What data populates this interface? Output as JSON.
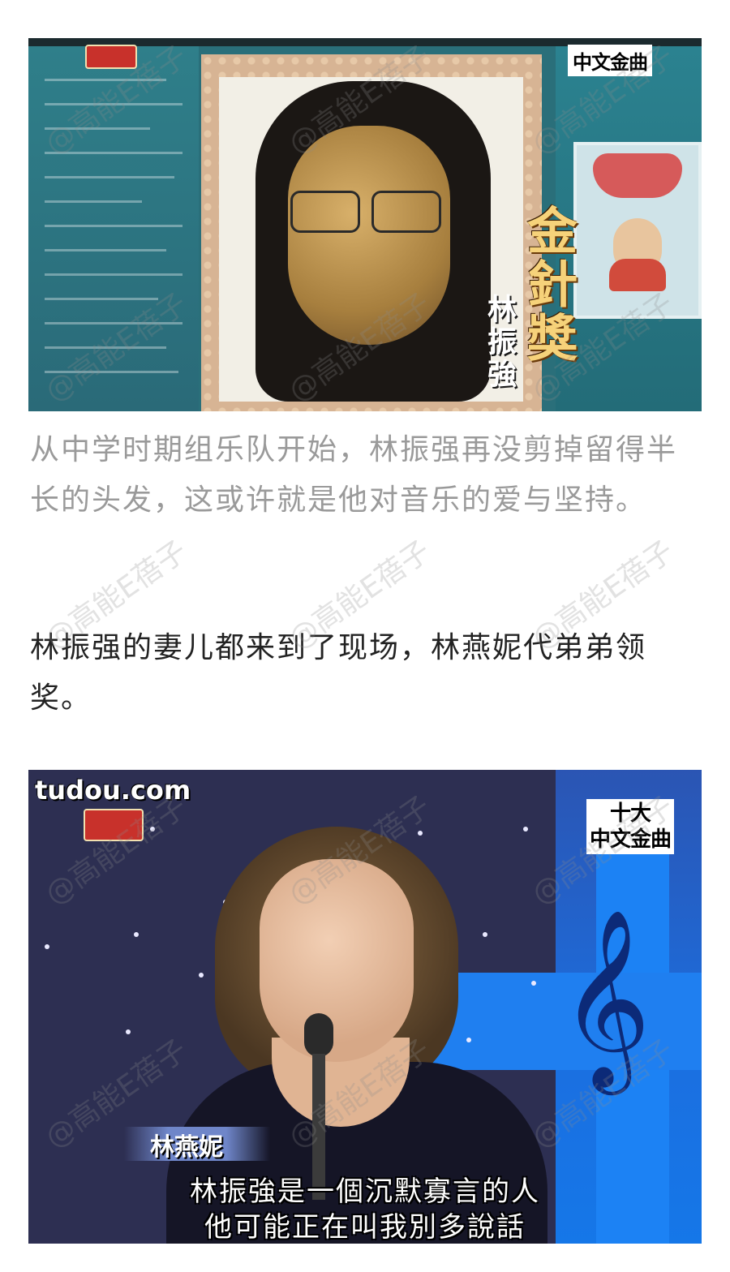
{
  "frame1": {
    "channel_badge": "中文金曲",
    "award_title": "金針獎",
    "recipient": "林振強"
  },
  "caption": "从中学时期组乐队开始，林振强再没剪掉留得半长的头发，这或许就是他对音乐的爱与坚持。",
  "body": "林振强的妻儿都来到了现场，林燕妮代弟弟领奖。",
  "frame2": {
    "site": "tudou.com",
    "channel_badge_line1": "十大",
    "channel_badge_line2": "中文金曲",
    "speaker_tag": "林燕妮",
    "subtitle_line1": "林振強是一個沉默寡言的人",
    "subtitle_line2": "他可能正在叫我別多說話"
  },
  "watermark": "@高能E蓓子"
}
